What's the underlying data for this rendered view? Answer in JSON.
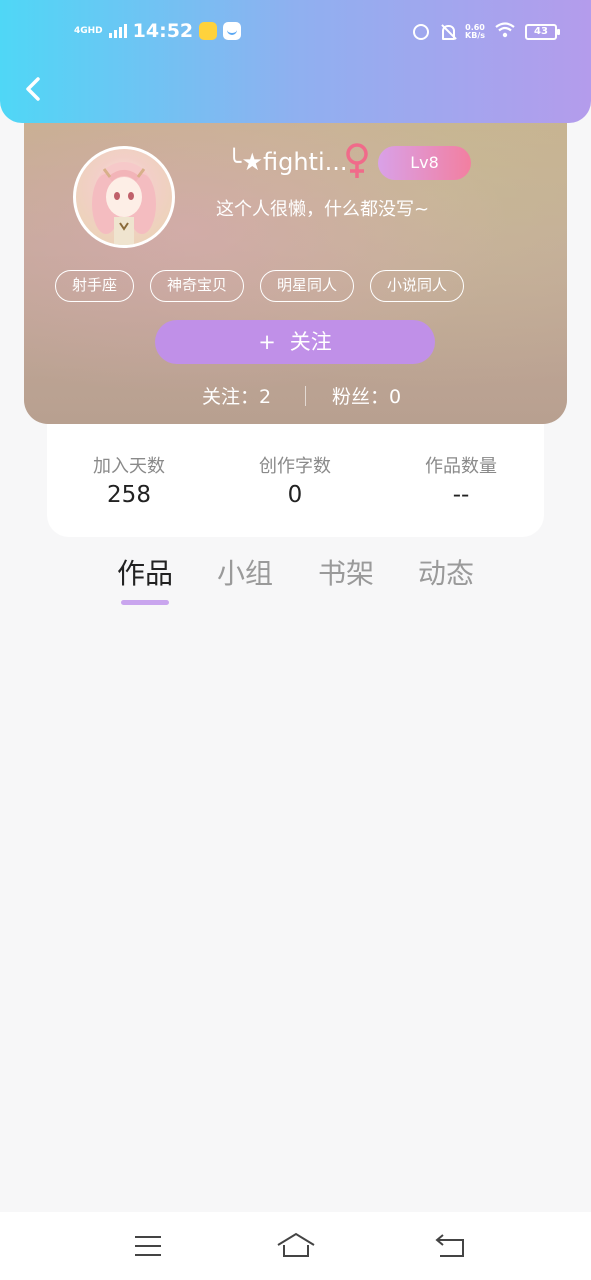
{
  "status_bar": {
    "network": "4GHD",
    "time": "14:52",
    "speed_value": "0.60",
    "speed_unit": "KB/s",
    "battery": "43"
  },
  "header": {
    "back_icon": "chevron-left-icon"
  },
  "profile": {
    "nickname": "╰★fighti...",
    "gender_icon": "female-icon",
    "level": "Lv8",
    "bio": "这个人很懒，什么都没写~",
    "tags": [
      "射手座",
      "神奇宝贝",
      "明星同人",
      "小说同人"
    ],
    "follow_button": {
      "plus": "+",
      "label": "关注"
    },
    "following": "关注：2",
    "fans": "粉丝：0"
  },
  "stats": [
    {
      "label": "加入天数",
      "value": "258"
    },
    {
      "label": "创作字数",
      "value": "0"
    },
    {
      "label": "作品数量",
      "value": "--"
    }
  ],
  "tabs": [
    {
      "label": "作品",
      "active": true
    },
    {
      "label": "小组",
      "active": false
    },
    {
      "label": "书架",
      "active": false
    },
    {
      "label": "动态",
      "active": false
    }
  ],
  "colors": {
    "header_start": "#4fd7f6",
    "header_end": "#b49cec",
    "follow_button": "#c090e8",
    "tab_indicator": "#c9a5ee",
    "level_badge_start": "#d9a1e8",
    "level_badge_end": "#f27fa0"
  },
  "nav": {
    "menu_icon": "menu-icon",
    "home_icon": "home-icon",
    "back_icon": "back-arrow-icon"
  }
}
